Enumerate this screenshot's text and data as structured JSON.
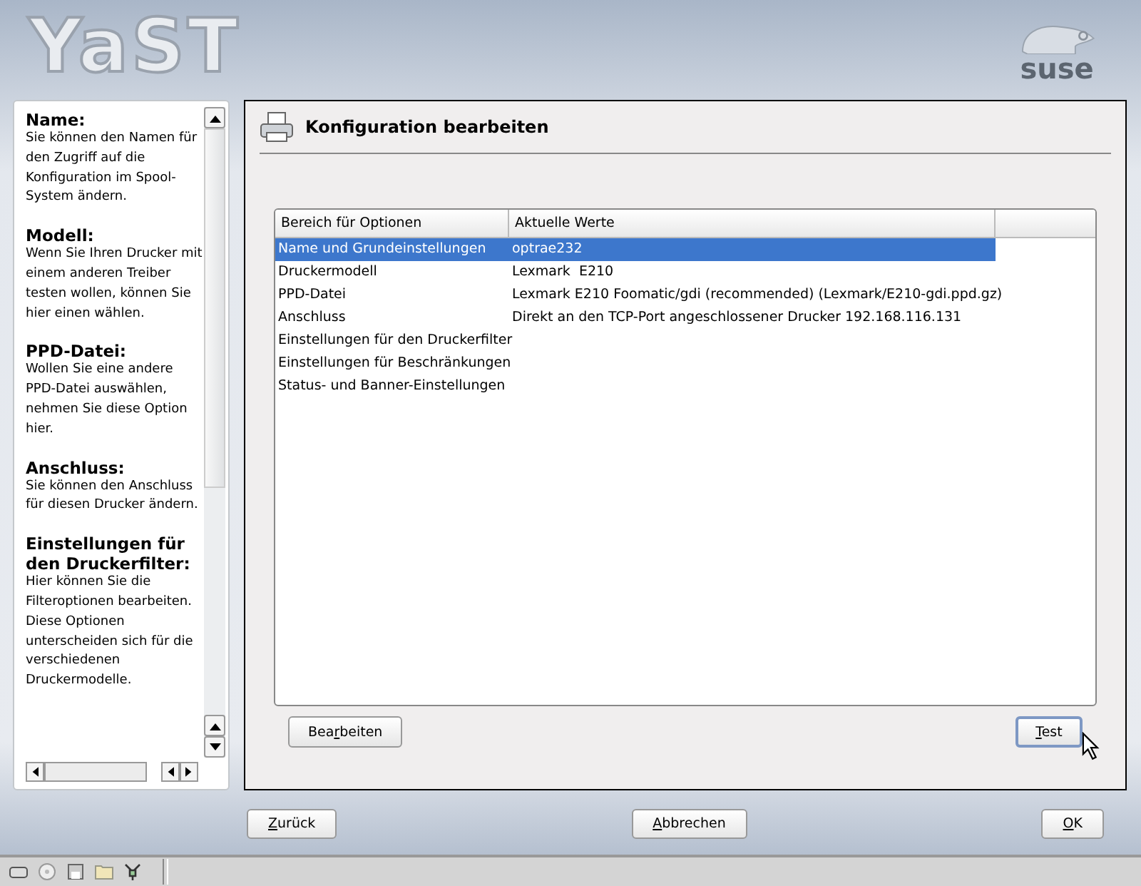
{
  "header": {
    "logo": "YaST",
    "brand": "suse"
  },
  "help": [
    {
      "heading": "Name:",
      "text": "Sie können den Namen für den Zugriff auf die Konfiguration im Spool-System ändern."
    },
    {
      "heading": "Modell:",
      "text": "Wenn Sie Ihren Drucker mit einem anderen Treiber testen wollen, können Sie hier einen wählen."
    },
    {
      "heading": "PPD-Datei:",
      "text": "Wollen Sie eine andere PPD-Datei auswählen, nehmen Sie diese Option hier."
    },
    {
      "heading": "Anschluss:",
      "text": "Sie können den Anschluss für diesen Drucker ändern."
    },
    {
      "heading": "Einstellungen für den Druckerfilter:",
      "text": "Hier können Sie die Filteroptionen bearbeiten. Diese Optionen unterscheiden sich für die verschiedenen Druckermodelle."
    }
  ],
  "dialog": {
    "title": "Konfiguration bearbeiten",
    "table": {
      "columns": [
        "Bereich für Optionen",
        "Aktuelle Werte"
      ],
      "rows": [
        {
          "option": "Name und Grundeinstellungen",
          "value": "optrae232",
          "selected": true
        },
        {
          "option": "Druckermodell",
          "value": "Lexmark  E210",
          "selected": false
        },
        {
          "option": "PPD-Datei",
          "value": "Lexmark E210 Foomatic/gdi (recommended) (Lexmark/E210-gdi.ppd.gz)",
          "selected": false
        },
        {
          "option": "Anschluss",
          "value": "Direkt an den TCP-Port angeschlossener Drucker 192.168.116.131",
          "selected": false
        },
        {
          "option": "Einstellungen für den Druckerfilter",
          "selected": false
        },
        {
          "option": "Einstellungen für Beschränkungen",
          "selected": false
        },
        {
          "option": "Status- und Banner-Einstellungen",
          "selected": false
        }
      ]
    },
    "buttons": [
      {
        "before": "Bea",
        "key": "r",
        "after": "beiten",
        "focused": false
      },
      {
        "key": "T",
        "after": "est",
        "focused": true
      }
    ]
  },
  "footer_buttons": [
    {
      "key": "Z",
      "after": "urück"
    },
    {
      "key": "A",
      "after": "bbrechen"
    },
    {
      "key": "O",
      "after": "K"
    }
  ]
}
